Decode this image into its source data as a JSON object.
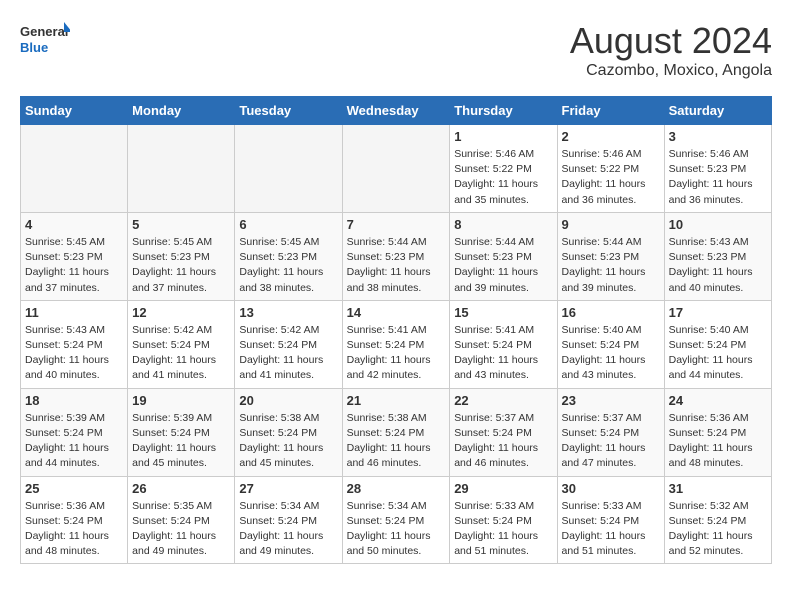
{
  "header": {
    "logo": {
      "general": "General",
      "blue": "Blue"
    },
    "title": "August 2024",
    "subtitle": "Cazombo, Moxico, Angola"
  },
  "weekdays": [
    "Sunday",
    "Monday",
    "Tuesday",
    "Wednesday",
    "Thursday",
    "Friday",
    "Saturday"
  ],
  "weeks": [
    [
      {
        "day": "",
        "empty": true
      },
      {
        "day": "",
        "empty": true
      },
      {
        "day": "",
        "empty": true
      },
      {
        "day": "",
        "empty": true
      },
      {
        "day": "1",
        "sunrise": "5:46 AM",
        "sunset": "5:22 PM",
        "daylight": "11 hours and 35 minutes."
      },
      {
        "day": "2",
        "sunrise": "5:46 AM",
        "sunset": "5:22 PM",
        "daylight": "11 hours and 36 minutes."
      },
      {
        "day": "3",
        "sunrise": "5:46 AM",
        "sunset": "5:23 PM",
        "daylight": "11 hours and 36 minutes."
      }
    ],
    [
      {
        "day": "4",
        "sunrise": "5:45 AM",
        "sunset": "5:23 PM",
        "daylight": "11 hours and 37 minutes."
      },
      {
        "day": "5",
        "sunrise": "5:45 AM",
        "sunset": "5:23 PM",
        "daylight": "11 hours and 37 minutes."
      },
      {
        "day": "6",
        "sunrise": "5:45 AM",
        "sunset": "5:23 PM",
        "daylight": "11 hours and 38 minutes."
      },
      {
        "day": "7",
        "sunrise": "5:44 AM",
        "sunset": "5:23 PM",
        "daylight": "11 hours and 38 minutes."
      },
      {
        "day": "8",
        "sunrise": "5:44 AM",
        "sunset": "5:23 PM",
        "daylight": "11 hours and 39 minutes."
      },
      {
        "day": "9",
        "sunrise": "5:44 AM",
        "sunset": "5:23 PM",
        "daylight": "11 hours and 39 minutes."
      },
      {
        "day": "10",
        "sunrise": "5:43 AM",
        "sunset": "5:23 PM",
        "daylight": "11 hours and 40 minutes."
      }
    ],
    [
      {
        "day": "11",
        "sunrise": "5:43 AM",
        "sunset": "5:24 PM",
        "daylight": "11 hours and 40 minutes."
      },
      {
        "day": "12",
        "sunrise": "5:42 AM",
        "sunset": "5:24 PM",
        "daylight": "11 hours and 41 minutes."
      },
      {
        "day": "13",
        "sunrise": "5:42 AM",
        "sunset": "5:24 PM",
        "daylight": "11 hours and 41 minutes."
      },
      {
        "day": "14",
        "sunrise": "5:41 AM",
        "sunset": "5:24 PM",
        "daylight": "11 hours and 42 minutes."
      },
      {
        "day": "15",
        "sunrise": "5:41 AM",
        "sunset": "5:24 PM",
        "daylight": "11 hours and 43 minutes."
      },
      {
        "day": "16",
        "sunrise": "5:40 AM",
        "sunset": "5:24 PM",
        "daylight": "11 hours and 43 minutes."
      },
      {
        "day": "17",
        "sunrise": "5:40 AM",
        "sunset": "5:24 PM",
        "daylight": "11 hours and 44 minutes."
      }
    ],
    [
      {
        "day": "18",
        "sunrise": "5:39 AM",
        "sunset": "5:24 PM",
        "daylight": "11 hours and 44 minutes."
      },
      {
        "day": "19",
        "sunrise": "5:39 AM",
        "sunset": "5:24 PM",
        "daylight": "11 hours and 45 minutes."
      },
      {
        "day": "20",
        "sunrise": "5:38 AM",
        "sunset": "5:24 PM",
        "daylight": "11 hours and 45 minutes."
      },
      {
        "day": "21",
        "sunrise": "5:38 AM",
        "sunset": "5:24 PM",
        "daylight": "11 hours and 46 minutes."
      },
      {
        "day": "22",
        "sunrise": "5:37 AM",
        "sunset": "5:24 PM",
        "daylight": "11 hours and 46 minutes."
      },
      {
        "day": "23",
        "sunrise": "5:37 AM",
        "sunset": "5:24 PM",
        "daylight": "11 hours and 47 minutes."
      },
      {
        "day": "24",
        "sunrise": "5:36 AM",
        "sunset": "5:24 PM",
        "daylight": "11 hours and 48 minutes."
      }
    ],
    [
      {
        "day": "25",
        "sunrise": "5:36 AM",
        "sunset": "5:24 PM",
        "daylight": "11 hours and 48 minutes."
      },
      {
        "day": "26",
        "sunrise": "5:35 AM",
        "sunset": "5:24 PM",
        "daylight": "11 hours and 49 minutes."
      },
      {
        "day": "27",
        "sunrise": "5:34 AM",
        "sunset": "5:24 PM",
        "daylight": "11 hours and 49 minutes."
      },
      {
        "day": "28",
        "sunrise": "5:34 AM",
        "sunset": "5:24 PM",
        "daylight": "11 hours and 50 minutes."
      },
      {
        "day": "29",
        "sunrise": "5:33 AM",
        "sunset": "5:24 PM",
        "daylight": "11 hours and 51 minutes."
      },
      {
        "day": "30",
        "sunrise": "5:33 AM",
        "sunset": "5:24 PM",
        "daylight": "11 hours and 51 minutes."
      },
      {
        "day": "31",
        "sunrise": "5:32 AM",
        "sunset": "5:24 PM",
        "daylight": "11 hours and 52 minutes."
      }
    ]
  ]
}
